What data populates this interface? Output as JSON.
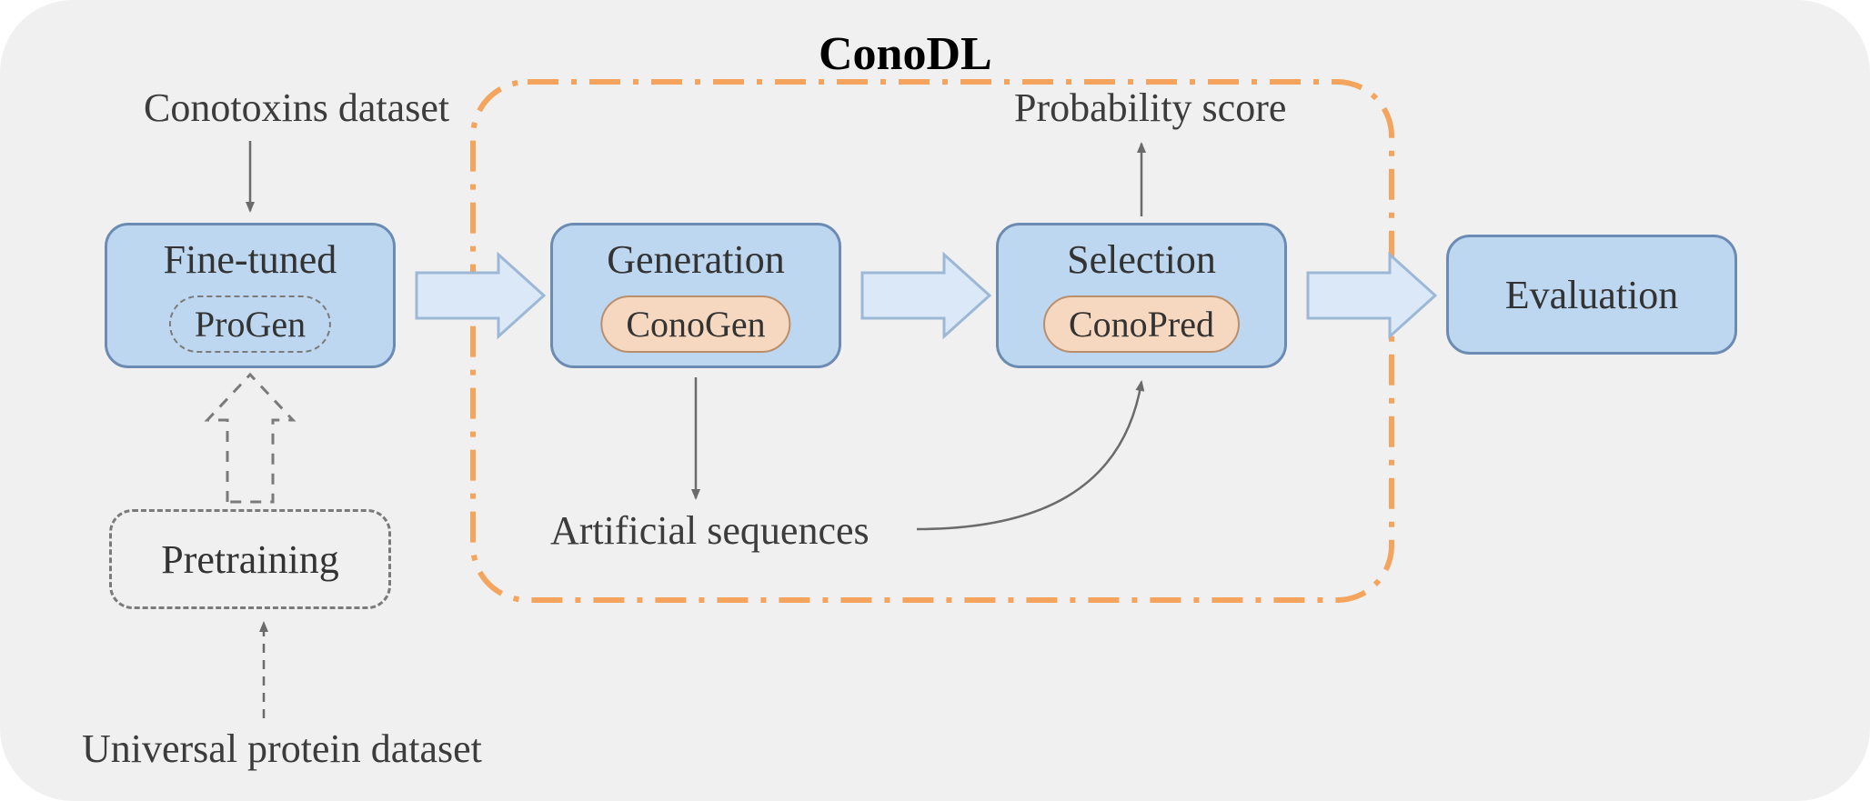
{
  "title": "ConoDL",
  "labels": {
    "conotoxins": "Conotoxins dataset",
    "probability": "Probability score",
    "artificial": "Artificial sequences",
    "universal": "Universal protein dataset"
  },
  "boxes": {
    "finetuned": {
      "title": "Fine-tuned",
      "sub": "ProGen"
    },
    "generation": {
      "title": "Generation",
      "sub": "ConoGen"
    },
    "selection": {
      "title": "Selection",
      "sub": "ConoPred"
    },
    "pretraining": "Pretraining",
    "evaluation": "Evaluation"
  },
  "colors": {
    "box_fill": "#bdd7f0",
    "box_border": "#6b8bb3",
    "pill_fill": "#f6d7bf",
    "pill_border": "#b98e6c",
    "dash_border": "#7a7a7a",
    "orange": "#f4a45d",
    "arrow_fill": "#dbe8f7",
    "arrow_stroke": "#9db8d6",
    "thin_arrow": "#6b6b6b"
  }
}
